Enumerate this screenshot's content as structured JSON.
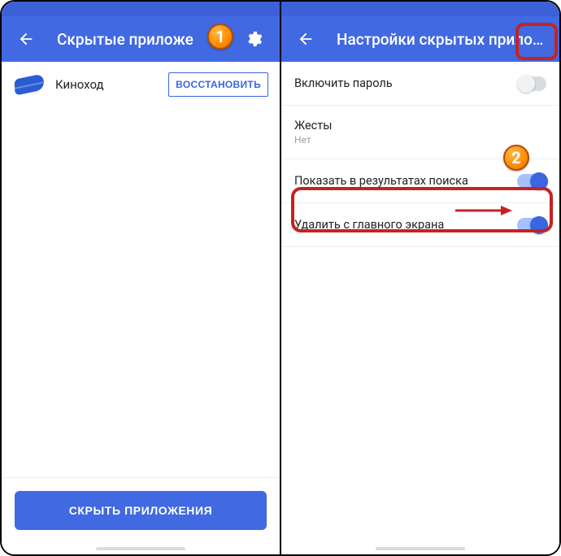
{
  "left": {
    "title": "Скрытые приложе",
    "app": {
      "name": "Киноход",
      "restore_label": "ВОССТАНОВИТЬ"
    },
    "hide_button": "СКРЫТЬ ПРИЛОЖЕНИЯ"
  },
  "right": {
    "title": "Настройки скрытых прило…",
    "rows": {
      "password": {
        "label": "Включить пароль",
        "on": false
      },
      "gestures": {
        "label": "Жесты",
        "sub": "Нет"
      },
      "search": {
        "label": "Показать в результатах поиска",
        "on": true
      },
      "remove": {
        "label": "Удалить с главного экрана",
        "on": true
      }
    }
  },
  "callouts": {
    "one": "1",
    "two": "2"
  }
}
